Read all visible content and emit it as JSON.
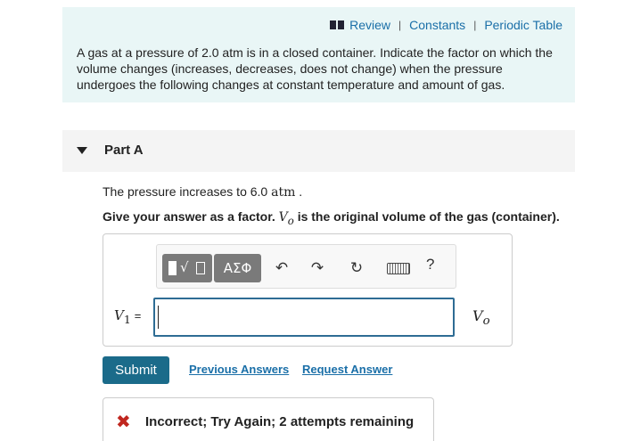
{
  "header": {
    "review": "Review",
    "separator": "|",
    "constants": "Constants",
    "periodic_table": "Periodic Table"
  },
  "intro": {
    "text": "A gas at a pressure of 2.0 atm is in a closed container. Indicate the factor on which the volume changes (increases, decreases, does not change) when the pressure undergoes the following changes at constant temperature and amount of gas."
  },
  "part": {
    "title": "Part A"
  },
  "question": {
    "text_before": "The pressure increases to 6.0 ",
    "unit": "atm",
    "text_after": " .",
    "instruction_before": "Give your answer as a factor. ",
    "var_symbol": "V",
    "var_subscript": "o",
    "instruction_after": " is the original volume of the gas (container)."
  },
  "toolbar": {
    "greek_label": "ΑΣΦ",
    "radical_glyph": "√",
    "undo_glyph": "↶",
    "redo_glyph": "↷",
    "reset_glyph": "↻",
    "help_glyph": "?"
  },
  "answer": {
    "lhs_symbol": "V",
    "lhs_subscript": "1",
    "lhs_equals": "=",
    "input_value": "",
    "unit_symbol": "V",
    "unit_subscript": "o"
  },
  "actions": {
    "submit": "Submit",
    "previous_answers": "Previous Answers",
    "request_answer": "Request Answer"
  },
  "feedback": {
    "icon": "✖",
    "text": "Incorrect; Try Again; 2 attempts remaining"
  },
  "colors": {
    "panel_bg": "#e9f6f6",
    "link": "#1a6fa8",
    "submit_bg": "#1b6b8a",
    "input_border": "#2e6c94",
    "error": "#c0271f"
  }
}
